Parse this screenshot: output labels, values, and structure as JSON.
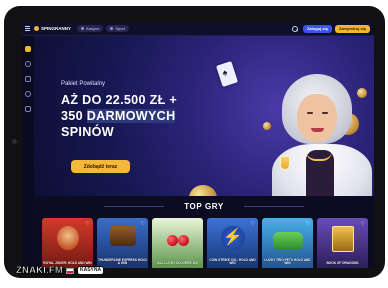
{
  "header": {
    "logo_text": "SPINGRANNY",
    "nav": [
      {
        "label": "Kasyno"
      },
      {
        "label": "Sport"
      }
    ],
    "login_label": "Zaloguj się",
    "register_label": "Zarejestruj się"
  },
  "hero": {
    "subtitle": "Pakiet Powitalny",
    "title_line1": "AŻ DO 22.500 ZŁ +",
    "title_line2_a": "350 ",
    "title_line2_hl": "DARMOWYCH",
    "title_line3": "SPINÓW",
    "cta_label": "Zdobądź teraz"
  },
  "top_games": {
    "title": "TOP GRY",
    "games": [
      {
        "name": "ROYAL JOKER: HOLD AND WIN"
      },
      {
        "name": "THUNDERLINE EXPRESS HOLD & WIN"
      },
      {
        "name": "ALL LUCKY CLOVERS 100"
      },
      {
        "name": "COIN STRIKE XXL: HOLD AND WIN"
      },
      {
        "name": "LUCKY TRIO PETS HOLD AND WIN"
      },
      {
        "name": "BOOK OF DRAGONS"
      }
    ]
  },
  "watermark": {
    "site": "ZNAKI.FM",
    "badge": "KASYNA"
  },
  "colors": {
    "accent_yellow": "#f4b83a",
    "login_blue": "#3a55e8",
    "background": "#0b0c22"
  }
}
